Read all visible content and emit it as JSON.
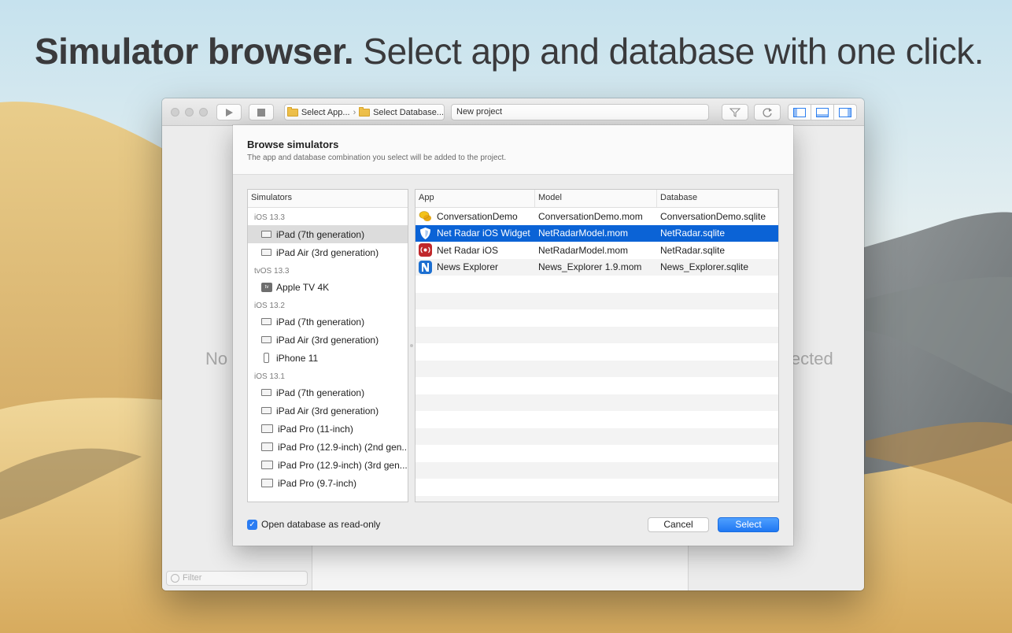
{
  "headline": {
    "bold": "Simulator browser.",
    "rest": " Select app and database with one click."
  },
  "toolbar": {
    "run_icon": "play-icon",
    "stop_icon": "stop-icon",
    "breadcrumb": [
      "Select App...",
      "Select Database..."
    ],
    "project_name": "New project",
    "right_icons": [
      "filter-icon",
      "refresh-icon",
      "left-panel-icon",
      "bottom-panel-icon",
      "right-panel-icon"
    ]
  },
  "background": {
    "left_placeholder": "No",
    "right_placeholder": "lected",
    "filter_placeholder": "Filter"
  },
  "sheet": {
    "title": "Browse simulators",
    "subtitle": "The app and database combination you select will be added to the project.",
    "simulators_header": "Simulators",
    "groups": [
      {
        "label": "iOS 13.3",
        "items": [
          {
            "name": "iPad (7th generation)",
            "icon": "ipad-icon",
            "selected": true
          },
          {
            "name": "iPad Air (3rd generation)",
            "icon": "ipad-icon"
          }
        ]
      },
      {
        "label": "tvOS 13.3",
        "items": [
          {
            "name": "Apple TV 4K",
            "icon": "tv-icon"
          }
        ]
      },
      {
        "label": "iOS 13.2",
        "items": [
          {
            "name": "iPad (7th generation)",
            "icon": "ipad-icon"
          },
          {
            "name": "iPad Air (3rd generation)",
            "icon": "ipad-icon"
          },
          {
            "name": "iPhone 11",
            "icon": "iphone-icon"
          }
        ]
      },
      {
        "label": "iOS 13.1",
        "items": [
          {
            "name": "iPad (7th generation)",
            "icon": "ipad-icon"
          },
          {
            "name": "iPad Air (3rd generation)",
            "icon": "ipad-icon"
          },
          {
            "name": "iPad Pro (11-inch)",
            "icon": "ipad-icon"
          },
          {
            "name": "iPad Pro (12.9-inch) (2nd gen...",
            "icon": "ipad-icon"
          },
          {
            "name": "iPad Pro (12.9-inch) (3rd gen...",
            "icon": "ipad-icon"
          },
          {
            "name": "iPad Pro (9.7-inch)",
            "icon": "ipad-icon"
          }
        ]
      }
    ],
    "apps_columns": [
      "App",
      "Model",
      "Database"
    ],
    "apps": [
      {
        "app": "ConversationDemo",
        "model": "ConversationDemo.mom",
        "database": "ConversationDemo.sqlite",
        "icon_color": "#f3c21a",
        "icon": "chat-bubbles-icon"
      },
      {
        "app": "Net Radar iOS Widget",
        "model": "NetRadarModel.mom",
        "database": "NetRadar.sqlite",
        "icon_color": "#ffffff",
        "icon": "shield-icon",
        "selected": true
      },
      {
        "app": "Net Radar iOS",
        "model": "NetRadarModel.mom",
        "database": "NetRadar.sqlite",
        "icon_color": "#c0282b",
        "icon": "radar-icon"
      },
      {
        "app": "News Explorer",
        "model": "News_Explorer 1.9.mom",
        "database": "News_Explorer.sqlite",
        "icon_color": "#1c6fd1",
        "icon": "news-n-icon"
      }
    ],
    "empty_rows": 14,
    "readonly_checkbox": {
      "label": "Open database as read-only",
      "checked": true
    },
    "cancel_label": "Cancel",
    "select_label": "Select"
  },
  "colors": {
    "selection": "#0b63d6",
    "primary_button": "#1f77f2"
  }
}
